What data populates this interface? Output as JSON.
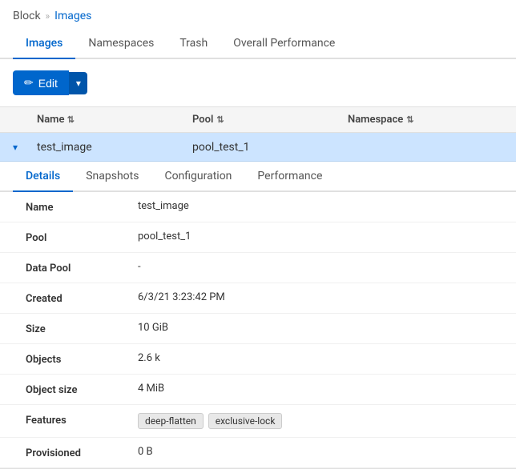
{
  "breadcrumb": {
    "root": "Block",
    "separator": "»",
    "current": "Images"
  },
  "tabs": [
    {
      "id": "images",
      "label": "Images",
      "active": true
    },
    {
      "id": "namespaces",
      "label": "Namespaces",
      "active": false
    },
    {
      "id": "trash",
      "label": "Trash",
      "active": false
    },
    {
      "id": "overall-performance",
      "label": "Overall Performance",
      "active": false
    }
  ],
  "toolbar": {
    "edit_label": "Edit"
  },
  "table": {
    "columns": [
      {
        "id": "name",
        "label": "Name",
        "sortable": true
      },
      {
        "id": "pool",
        "label": "Pool",
        "sortable": true
      },
      {
        "id": "namespace",
        "label": "Namespace",
        "sortable": true
      }
    ],
    "row": {
      "name": "test_image",
      "pool": "pool_test_1",
      "namespace": ""
    }
  },
  "detail": {
    "inner_tabs": [
      {
        "id": "details",
        "label": "Details",
        "active": true
      },
      {
        "id": "snapshots",
        "label": "Snapshots",
        "active": false
      },
      {
        "id": "configuration",
        "label": "Configuration",
        "active": false
      },
      {
        "id": "performance",
        "label": "Performance",
        "active": false
      }
    ],
    "fields": [
      {
        "label": "Name",
        "value": "test_image",
        "type": "text"
      },
      {
        "label": "Pool",
        "value": "pool_test_1",
        "type": "text"
      },
      {
        "label": "Data Pool",
        "value": "-",
        "type": "text"
      },
      {
        "label": "Created",
        "value": "6/3/21 3:23:42 PM",
        "type": "text"
      },
      {
        "label": "Size",
        "value": "10 GiB",
        "type": "text"
      },
      {
        "label": "Objects",
        "value": "2.6 k",
        "type": "text"
      },
      {
        "label": "Object size",
        "value": "4 MiB",
        "type": "text"
      },
      {
        "label": "Features",
        "value": "",
        "type": "badges",
        "badges": [
          "deep-flatten",
          "exclusive-lock"
        ]
      },
      {
        "label": "Provisioned",
        "value": "0 B",
        "type": "text"
      }
    ]
  }
}
